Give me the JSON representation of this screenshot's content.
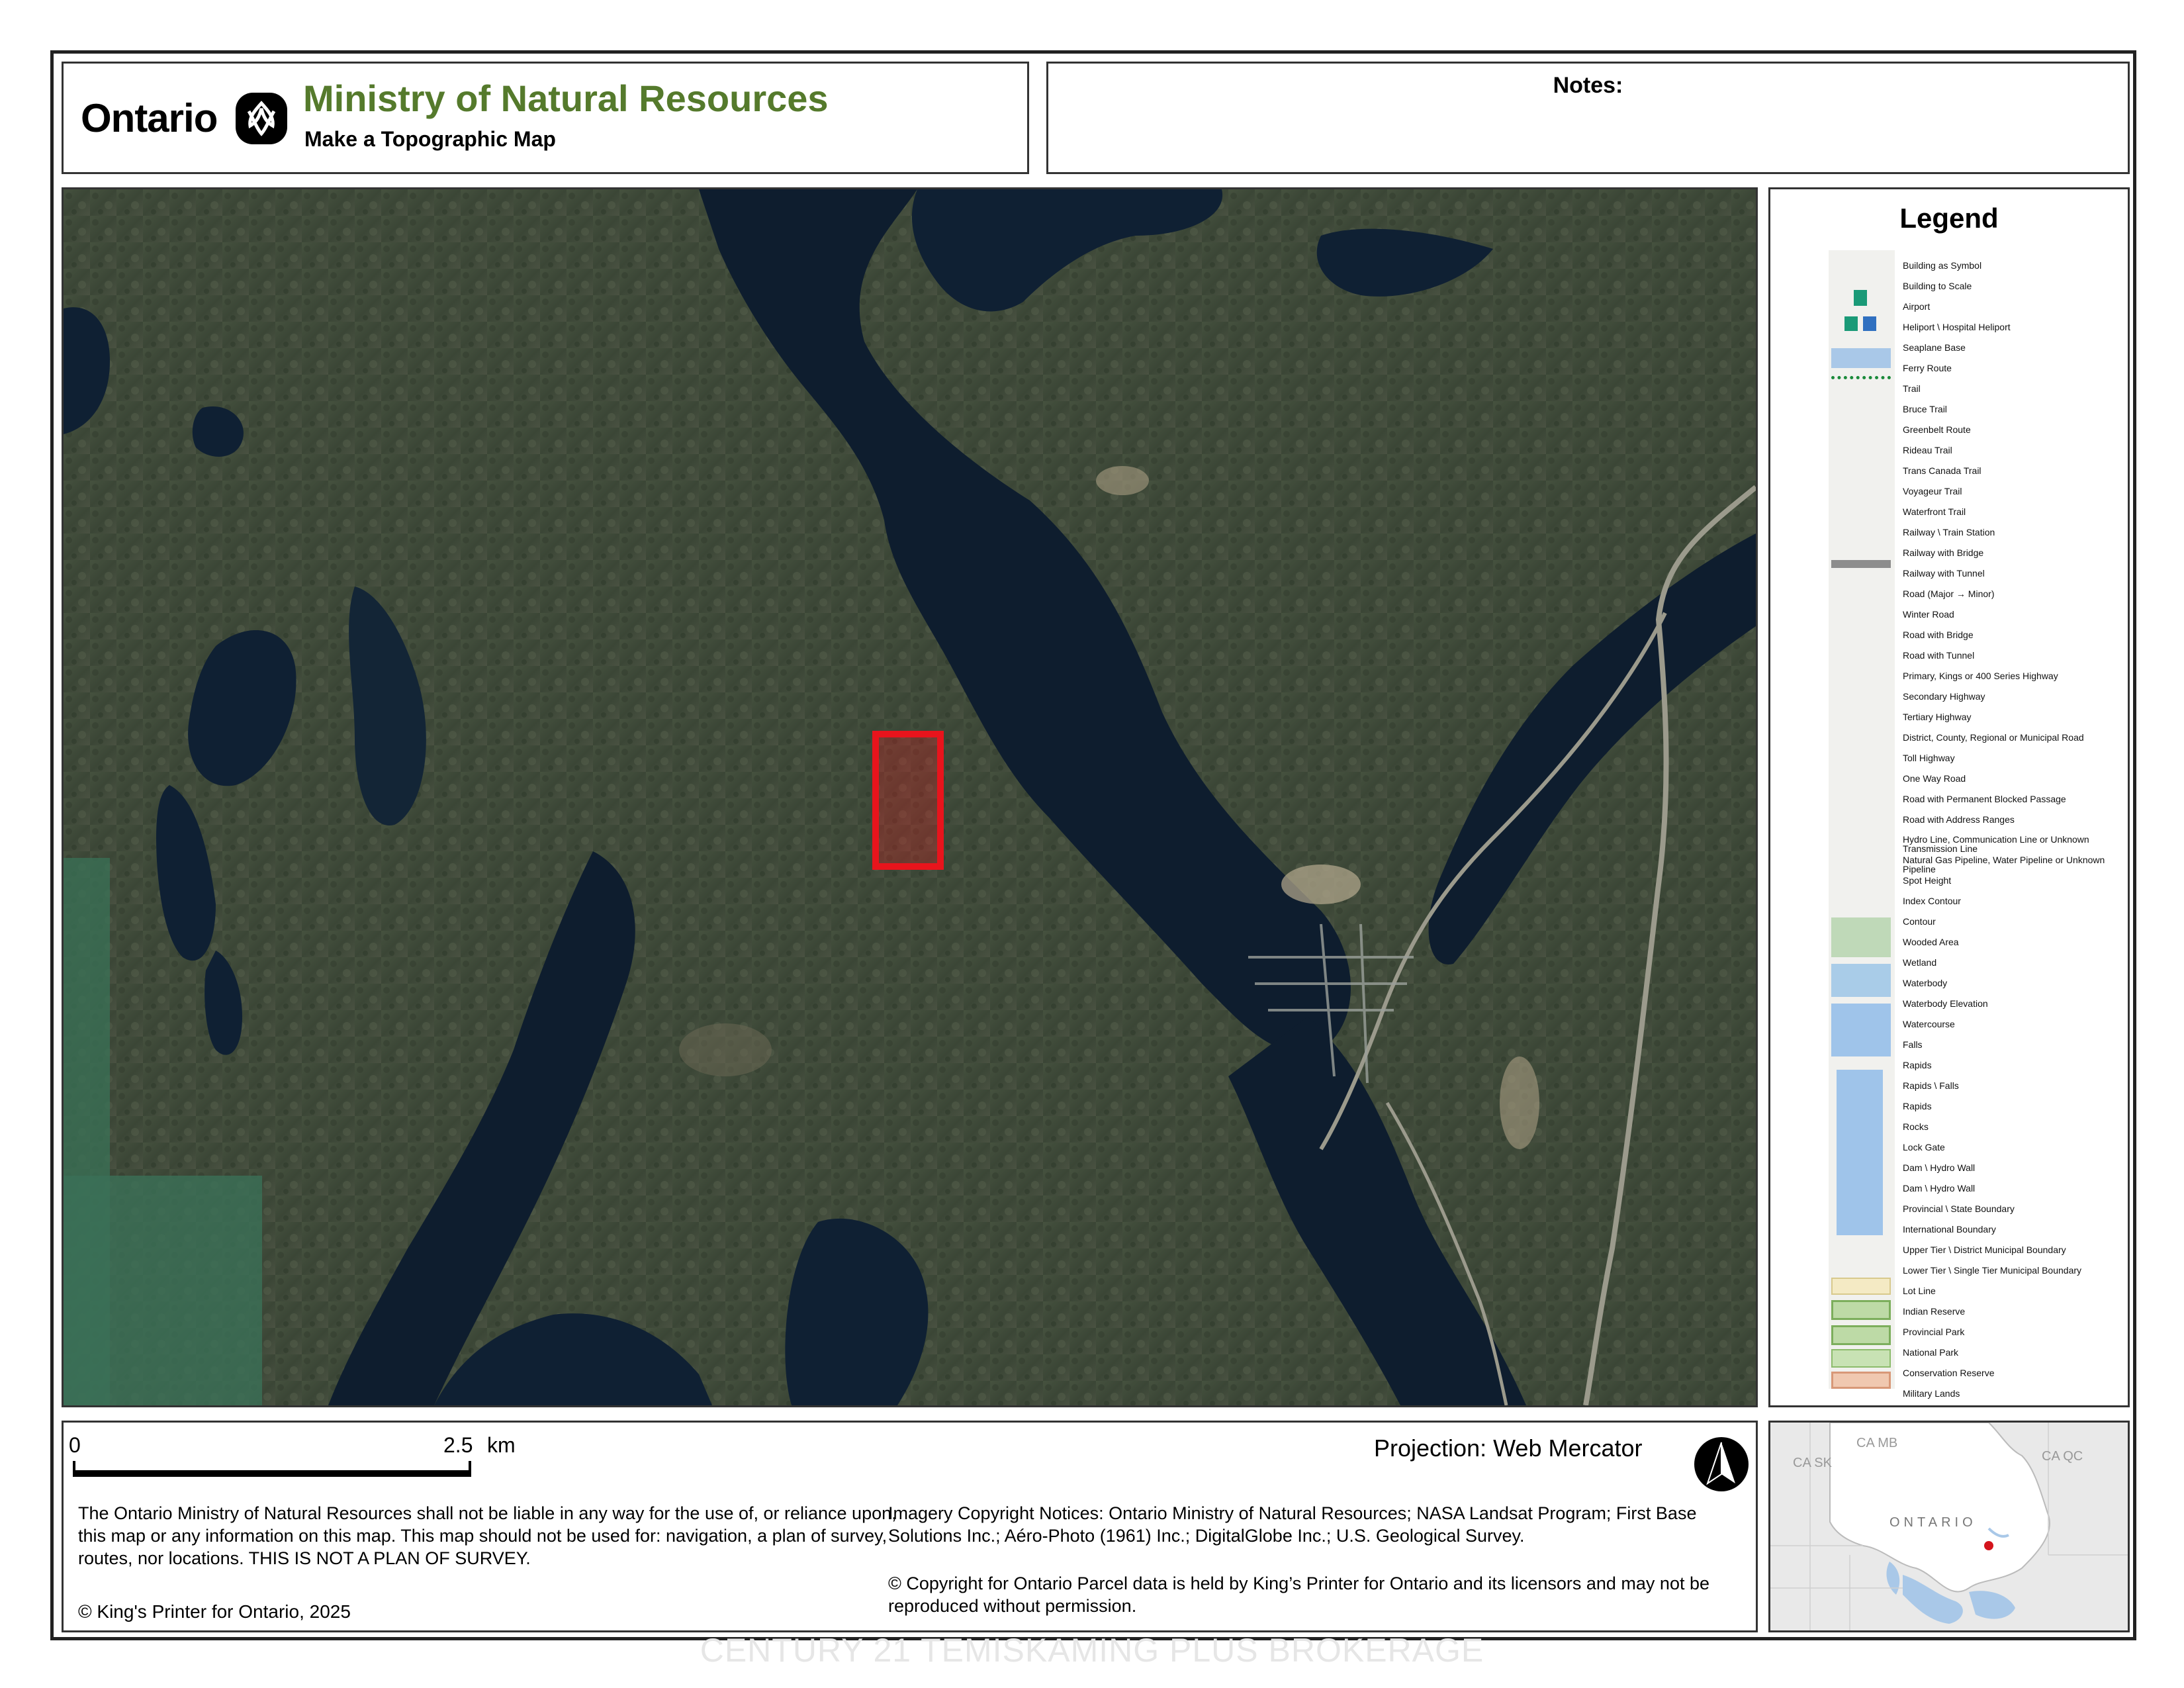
{
  "header": {
    "ontario_word": "Ontario",
    "ministry": "Ministry of Natural Resources",
    "subtitle": "Make a Topographic Map",
    "ministry_color": "#557a2c"
  },
  "notes": {
    "label": "Notes:"
  },
  "map": {
    "highlight_color": "#e8141c",
    "water_color": "#0e1d2e",
    "forest_color": "#3e4a38"
  },
  "legend": {
    "title": "Legend",
    "items": [
      "Building as Symbol",
      "Building to Scale",
      "Airport",
      "Heliport \\ Hospital Heliport",
      "Seaplane Base",
      "Ferry Route",
      "Trail",
      "Bruce Trail",
      "Greenbelt Route",
      "Rideau Trail",
      "Trans Canada Trail",
      "Voyageur Trail",
      "Waterfront Trail",
      "Railway \\ Train Station",
      "Railway with Bridge",
      "Railway with Tunnel",
      "Road (Major → Minor)",
      "Winter Road",
      "Road with Bridge",
      "Road with Tunnel",
      "Primary, Kings or 400 Series Highway",
      "Secondary Highway",
      "Tertiary Highway",
      "District, County, Regional or Municipal Road",
      "Toll Highway",
      "One Way Road",
      "Road with Permanent Blocked Passage",
      "Road with Address Ranges",
      "Hydro Line, Communication Line or Unknown Transmission Line",
      "Natural Gas Pipeline, Water Pipeline or Unknown Pipeline",
      "Spot Height",
      "Index Contour",
      "Contour",
      "Wooded Area",
      "Wetland",
      "Waterbody",
      "Waterbody Elevation",
      "Watercourse",
      "Falls",
      "Rapids",
      "Rapids \\ Falls",
      "Rapids",
      "Rocks",
      "Lock Gate",
      "Dam \\ Hydro Wall",
      "Dam \\ Hydro Wall",
      "Provincial \\ State Boundary",
      "International Boundary",
      "Upper Tier \\ District Municipal Boundary",
      "Lower Tier \\ Single Tier Municipal Boundary",
      "Lot Line",
      "Indian Reserve",
      "Provincial Park",
      "National Park",
      "Conservation Reserve",
      "Military Lands"
    ]
  },
  "scale": {
    "zero": "0",
    "max": "2.5",
    "unit": "km"
  },
  "projection": "Projection: Web Mercator",
  "north_arrow_icon": "north-arrow-icon",
  "disclaimer": "The Ontario Ministry of Natural Resources shall not be liable in any way for the use of, or reliance upon, this map or any information on this map.  This map should not be used for: navigation, a plan of survey, routes, nor locations. THIS IS NOT A PLAN OF SURVEY.",
  "copyright_king": "© King's Printer for Ontario,  2025",
  "imagery_notice": "Imagery Copyright Notices: Ontario Ministry of Natural Resources; NASA Landsat Program; First Base Solutions Inc.; Aéro-Photo (1961) Inc.; DigitalGlobe Inc.; U.S. Geological Survey.",
  "parcel_notice": "© Copyright for Ontario Parcel data is held by King’s Printer for Ontario and its licensors and may not be reproduced without permission.",
  "inset": {
    "province_label": "ONTARIO",
    "labels": [
      "CA SK",
      "CA MB",
      "CA QC"
    ],
    "location_color": "#d4141c"
  },
  "watermark": "CENTURY 21 TEMISKAMING PLUS BROKERAGE"
}
